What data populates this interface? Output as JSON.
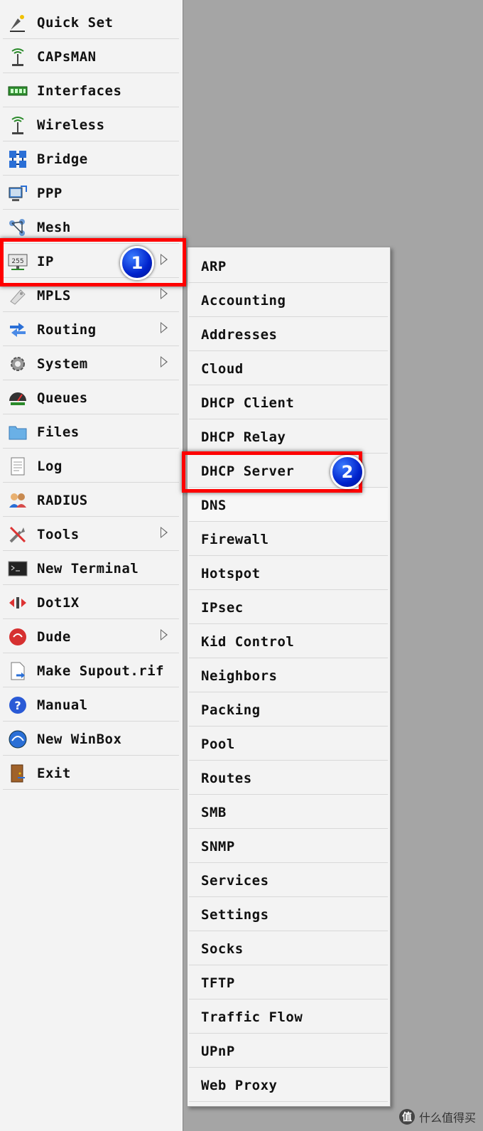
{
  "menu": {
    "items": [
      {
        "label": "Quick Set",
        "icon": "quick-set-icon",
        "submenu": false
      },
      {
        "label": "CAPsMAN",
        "icon": "antenna-icon",
        "submenu": false
      },
      {
        "label": "Interfaces",
        "icon": "network-card-icon",
        "submenu": false
      },
      {
        "label": "Wireless",
        "icon": "antenna-icon",
        "submenu": false
      },
      {
        "label": "Bridge",
        "icon": "bridge-icon",
        "submenu": false
      },
      {
        "label": "PPP",
        "icon": "ppp-icon",
        "submenu": false
      },
      {
        "label": "Mesh",
        "icon": "mesh-icon",
        "submenu": false
      },
      {
        "label": "IP",
        "icon": "ip-icon",
        "submenu": true
      },
      {
        "label": "MPLS",
        "icon": "mpls-icon",
        "submenu": true
      },
      {
        "label": "Routing",
        "icon": "routing-icon",
        "submenu": true
      },
      {
        "label": "System",
        "icon": "gear-icon",
        "submenu": true
      },
      {
        "label": "Queues",
        "icon": "queues-icon",
        "submenu": false
      },
      {
        "label": "Files",
        "icon": "folder-icon",
        "submenu": false
      },
      {
        "label": "Log",
        "icon": "log-icon",
        "submenu": false
      },
      {
        "label": "RADIUS",
        "icon": "users-icon",
        "submenu": false
      },
      {
        "label": "Tools",
        "icon": "tools-icon",
        "submenu": true
      },
      {
        "label": "New Terminal",
        "icon": "terminal-icon",
        "submenu": false
      },
      {
        "label": "Dot1X",
        "icon": "dot1x-icon",
        "submenu": false
      },
      {
        "label": "Dude",
        "icon": "dude-icon",
        "submenu": true
      },
      {
        "label": "Make Supout.rif",
        "icon": "file-export-icon",
        "submenu": false
      },
      {
        "label": "Manual",
        "icon": "help-icon",
        "submenu": false
      },
      {
        "label": "New WinBox",
        "icon": "winbox-icon",
        "submenu": false
      },
      {
        "label": "Exit",
        "icon": "exit-door-icon",
        "submenu": false
      }
    ]
  },
  "submenu": {
    "items": [
      "ARP",
      "Accounting",
      "Addresses",
      "Cloud",
      "DHCP Client",
      "DHCP Relay",
      "DHCP Server",
      "DNS",
      "Firewall",
      "Hotspot",
      "IPsec",
      "Kid Control",
      "Neighbors",
      "Packing",
      "Pool",
      "Routes",
      "SMB",
      "SNMP",
      "Services",
      "Settings",
      "Socks",
      "TFTP",
      "Traffic Flow",
      "UPnP",
      "Web Proxy"
    ]
  },
  "annotations": {
    "step1": "1",
    "step2": "2"
  },
  "watermark": {
    "text": "什么值得买",
    "icon_text": "值"
  },
  "colors": {
    "highlight": "#ff0000",
    "badge": "#0022cc",
    "workspace": "#a5a5a5",
    "menu_bg": "#f3f3f3"
  }
}
